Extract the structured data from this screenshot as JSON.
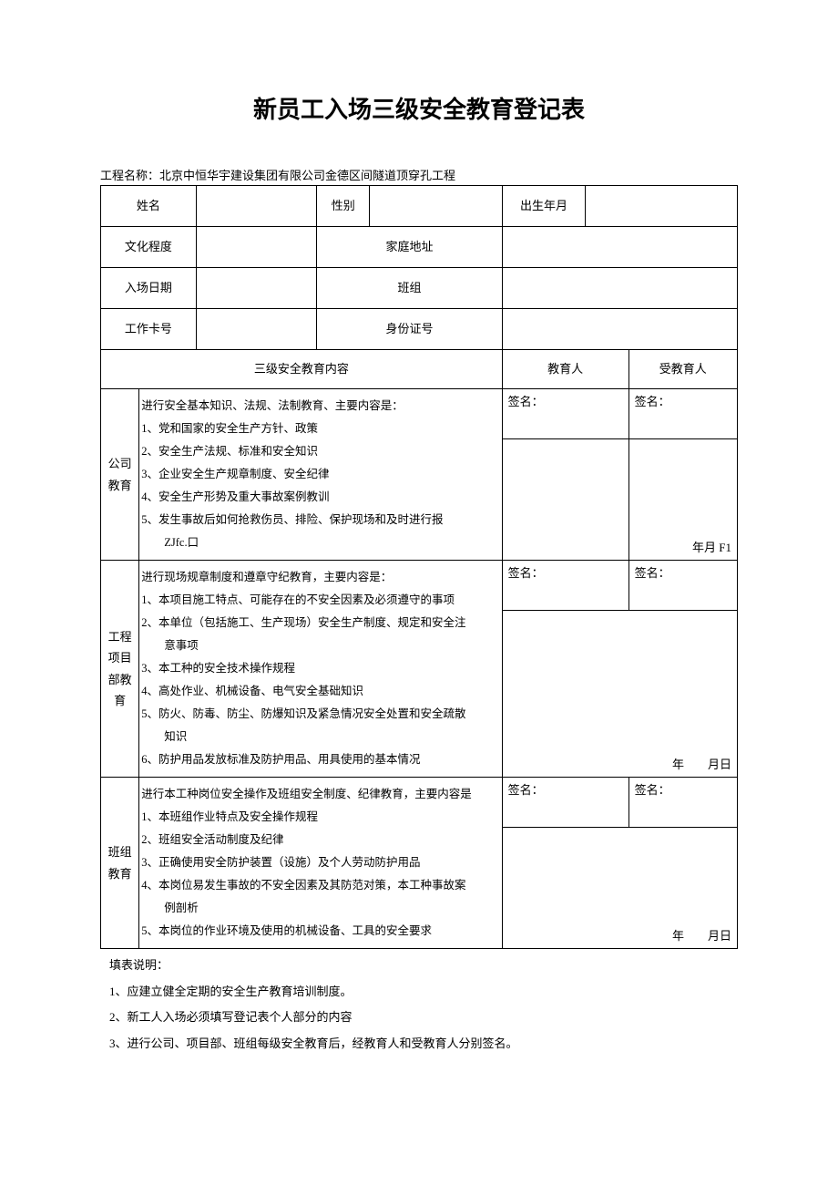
{
  "title": "新员工入场三级安全教育登记表",
  "project_label": "工程名称：",
  "project_name": "北京中恒华宇建设集团有限公司金德区间隧道顶穿孔工程",
  "row1": {
    "name_label": "姓名",
    "name_value": "",
    "gender_label": "性别",
    "gender_value": "",
    "birth_label": "出生年月",
    "birth_value": ""
  },
  "row2": {
    "edu_label": "文化程度",
    "edu_value": "",
    "addr_label": "家庭地址",
    "addr_value": ""
  },
  "row3": {
    "date_label": "入场日期",
    "date_value": "",
    "team_label": "班组",
    "team_value": ""
  },
  "row4": {
    "card_label": "工作卡号",
    "card_value": "",
    "id_label": "身份证号",
    "id_value": ""
  },
  "header": {
    "content_label": "三级安全教育内容",
    "educator_label": "教育人",
    "educatee_label": "受教育人"
  },
  "sig": "签名：",
  "date1": "年月 F1",
  "date2": "年  月日",
  "date3": "年  月日",
  "section1": {
    "label": "公司教育",
    "body": "进行安全基本知识、法规、法制教育、主要内容是：\n1、党和国家的安全生产方针、政策\n2、安全生产法规、标准和安全知识\n3、企业安全生产规章制度、安全纪律\n4、安全生产形势及重大事故案例教训\n5、发生事故后如何抢救伤员、排险、保护现场和及时进行报\n  ZJfc.口"
  },
  "section2": {
    "label": "工程项目部教育",
    "body": "进行现场规章制度和遵章守纪教育，主要内容是：\n1、本项目施工特点、可能存在的不安全因素及必须遵守的事项\n2、本单位（包括施工、生产现场）安全生产制度、规定和安全注\n  意事项\n3、本工种的安全技术操作规程\n4、高处作业、机械设备、电气安全基础知识\n5、防火、防毒、防尘、防爆知识及紧急情况安全处置和安全疏散\n  知识\n6、防护用品发放标准及防护用品、用具使用的基本情况"
  },
  "section3": {
    "label": "班组教育",
    "body": "进行本工种岗位安全操作及班组安全制度、纪律教育，主要内容是\n1、本班组作业特点及安全操作规程\n2、班组安全活动制度及纪律\n3、正确使用安全防护装置（设施）及个人劳动防护用品\n4、本岗位易发生事故的不安全因素及其防范对策，本工种事故案\n  例剖析\n5、本岗位的作业环境及使用的机械设备、工具的安全要求"
  },
  "notes_label": "填表说明：",
  "notes": [
    "1、应建立健全定期的安全生产教育培训制度。",
    "2、新工人入场必须填写登记表个人部分的内容",
    "3、进行公司、项目部、班组每级安全教育后，经教育人和受教育人分别签名。"
  ]
}
